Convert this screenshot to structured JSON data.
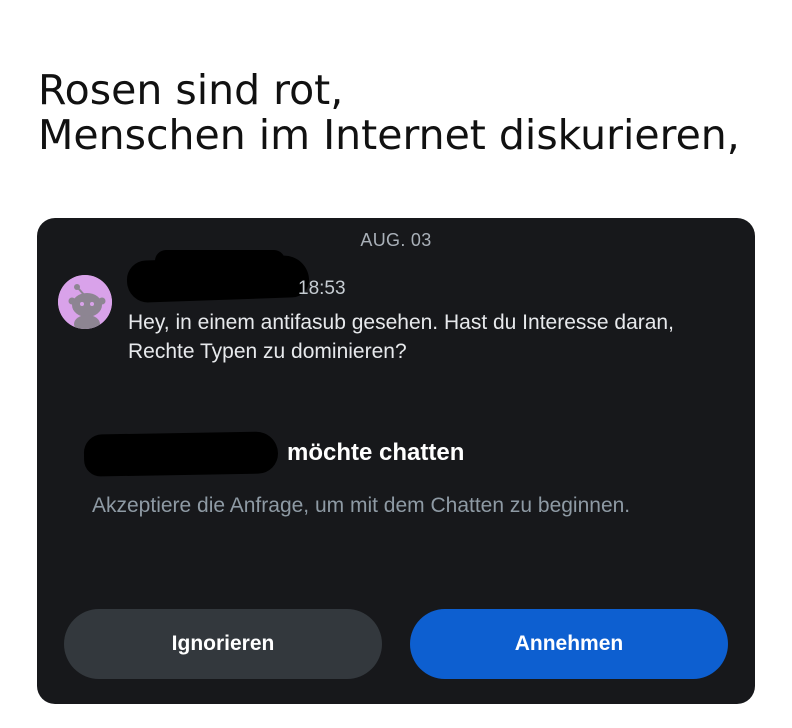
{
  "caption": {
    "line1": "Rosen sind rot,",
    "line2": "Menschen im Internet diskurieren,"
  },
  "chat": {
    "date_divider": "AUG. 03",
    "sender_name": "",
    "time": "18:53",
    "message": "Hey, in einem antifasub gesehen. Hast du Interesse daran, Rechte Typen zu dominieren?",
    "avatar_icon": "reddit-snoo-icon",
    "avatar_color": "#d9a2ea"
  },
  "request": {
    "title": "möchte chatten",
    "hint": "Akzeptiere die Anfrage, um mit dem Chatten zu beginnen."
  },
  "buttons": {
    "ignore_label": "Ignorieren",
    "accept_label": "Annehmen",
    "accept_color": "#0d5fd0",
    "ignore_color": "#33383d"
  }
}
